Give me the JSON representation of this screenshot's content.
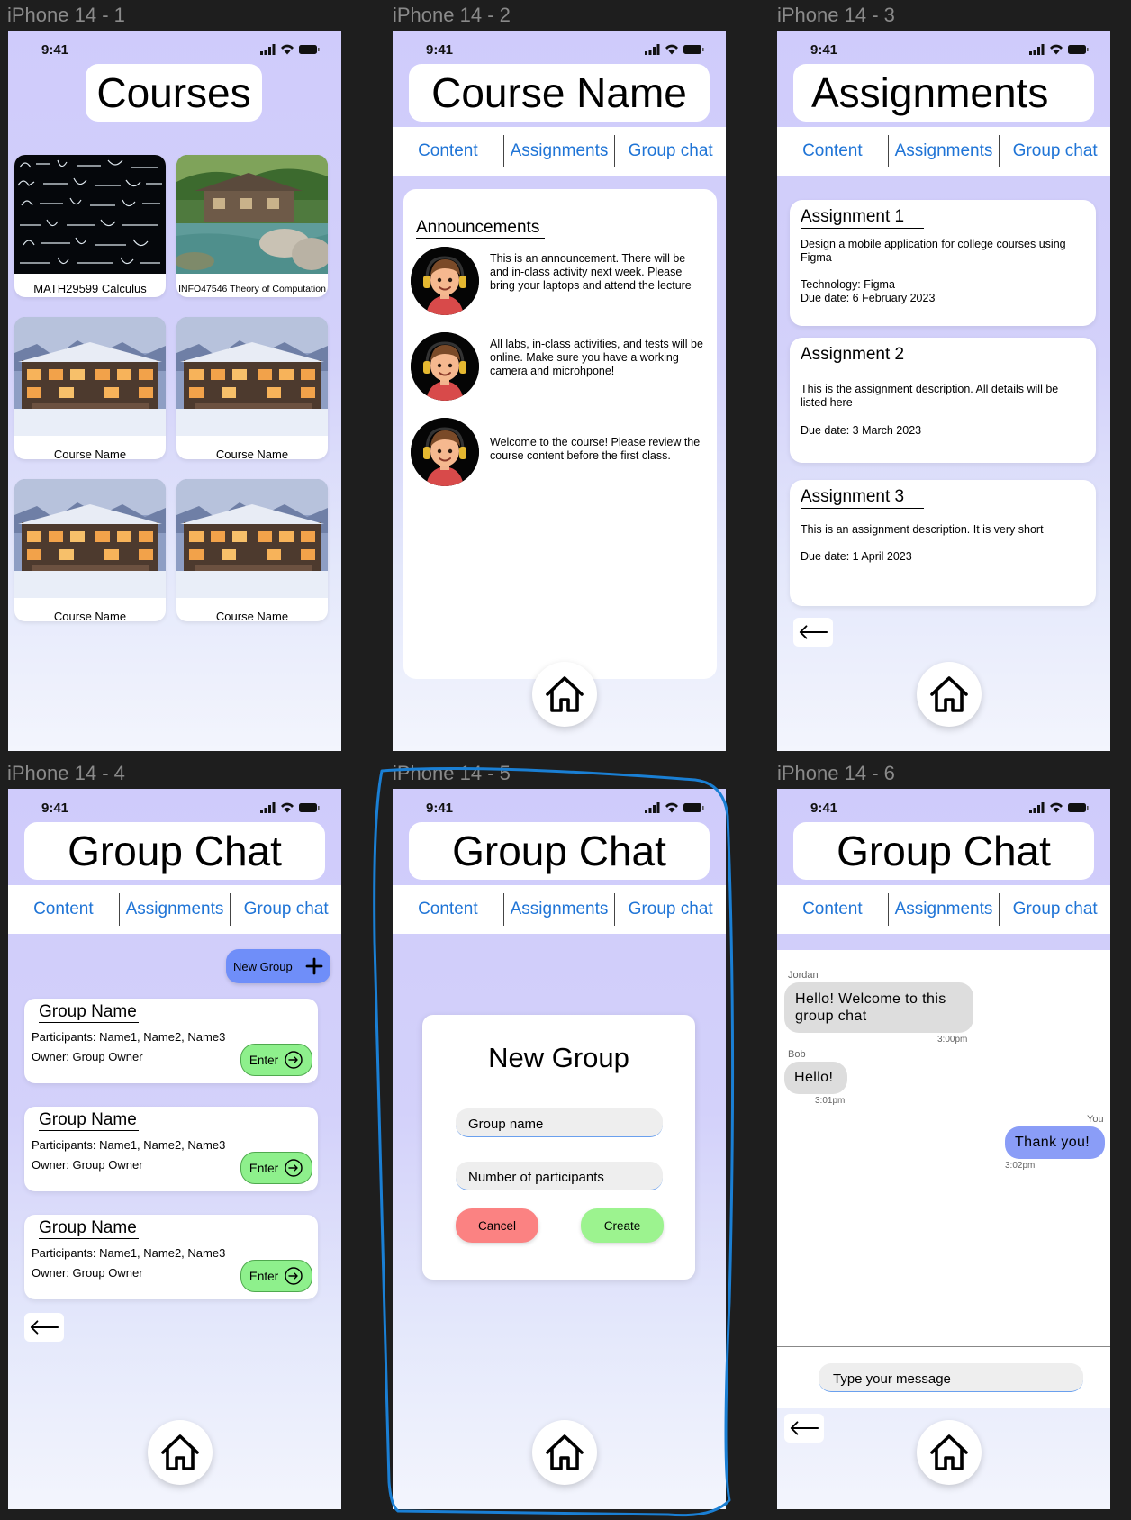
{
  "frames": [
    "iPhone 14 - 1",
    "iPhone 14 - 2",
    "iPhone 14 - 3",
    "iPhone 14 - 4",
    "iPhone 14 - 5",
    "iPhone 14 - 6"
  ],
  "status_time": "9:41",
  "tabs": [
    "Content",
    "Assignments",
    "Group chat"
  ],
  "screen1": {
    "title": "Courses",
    "courses": [
      "MATH29599 Calculus",
      "INFO47546 Theory of Computation",
      "Course Name",
      "Course Name",
      "Course Name",
      "Course Name"
    ]
  },
  "screen2": {
    "title": "Course Name",
    "heading": "Announcements",
    "announcements": [
      "This is an announcement. There will be and in-class activity next week. Please bring your laptops and attend the lecture",
      "All labs, in-class activities, and tests will be online. Make sure you have a working camera and microhpone!",
      "Welcome to the course! Please review the course content before the first class."
    ]
  },
  "screen3": {
    "title": "Assignments",
    "assignments": [
      {
        "title": "Assignment 1",
        "desc": "Design a mobile application for college courses using Figma",
        "extra": "Technology: Figma",
        "due": "Due date: 6 February 2023"
      },
      {
        "title": "Assignment 2",
        "desc": "This is the assignment description. All details will be listed here",
        "due": "Due date: 3 March 2023"
      },
      {
        "title": "Assignment 3",
        "desc": "This is an assignment description. It is very short",
        "due": "Due date: 1 April 2023"
      }
    ]
  },
  "screen4": {
    "title": "Group Chat",
    "new_group_label": "New Group",
    "groups": [
      {
        "name": "Group Name",
        "participants": "Participants: Name1, Name2, Name3",
        "owner": "Owner: Group Owner",
        "enter": "Enter"
      },
      {
        "name": "Group Name",
        "participants": "Participants: Name1, Name2, Name3",
        "owner": "Owner: Group Owner",
        "enter": "Enter"
      },
      {
        "name": "Group Name",
        "participants": "Participants: Name1, Name2, Name3",
        "owner": "Owner: Group Owner",
        "enter": "Enter"
      }
    ]
  },
  "screen5": {
    "title": "Group Chat",
    "modal_title": "New Group",
    "group_name_placeholder": "Group name",
    "participants_placeholder": "Number of participants",
    "cancel": "Cancel",
    "create": "Create"
  },
  "screen6": {
    "title": "Group Chat",
    "messages": [
      {
        "sender": "Jordan",
        "text": "Hello! Welcome to this group chat",
        "time": "3:00pm"
      },
      {
        "sender": "Bob",
        "text": "Hello!",
        "time": "3:01pm"
      },
      {
        "sender": "You",
        "text": "Thank you!",
        "time": "3:02pm"
      }
    ],
    "input_placeholder": "Type your message"
  },
  "colors": {
    "tab_blue": "#1f74d6",
    "enter_green": "#8ef08c",
    "new_group_blue": "#6f8ef9",
    "cancel_red": "#fb8282",
    "create_green": "#9cf38f",
    "my_bubble": "#8a9df7",
    "other_bubble": "#dddddd",
    "selection_outline": "#1a7fd4"
  },
  "icons": [
    "home-icon",
    "back-arrow-icon",
    "plus-icon",
    "enter-arrow-icon",
    "signal-icon",
    "wifi-icon",
    "battery-icon"
  ]
}
